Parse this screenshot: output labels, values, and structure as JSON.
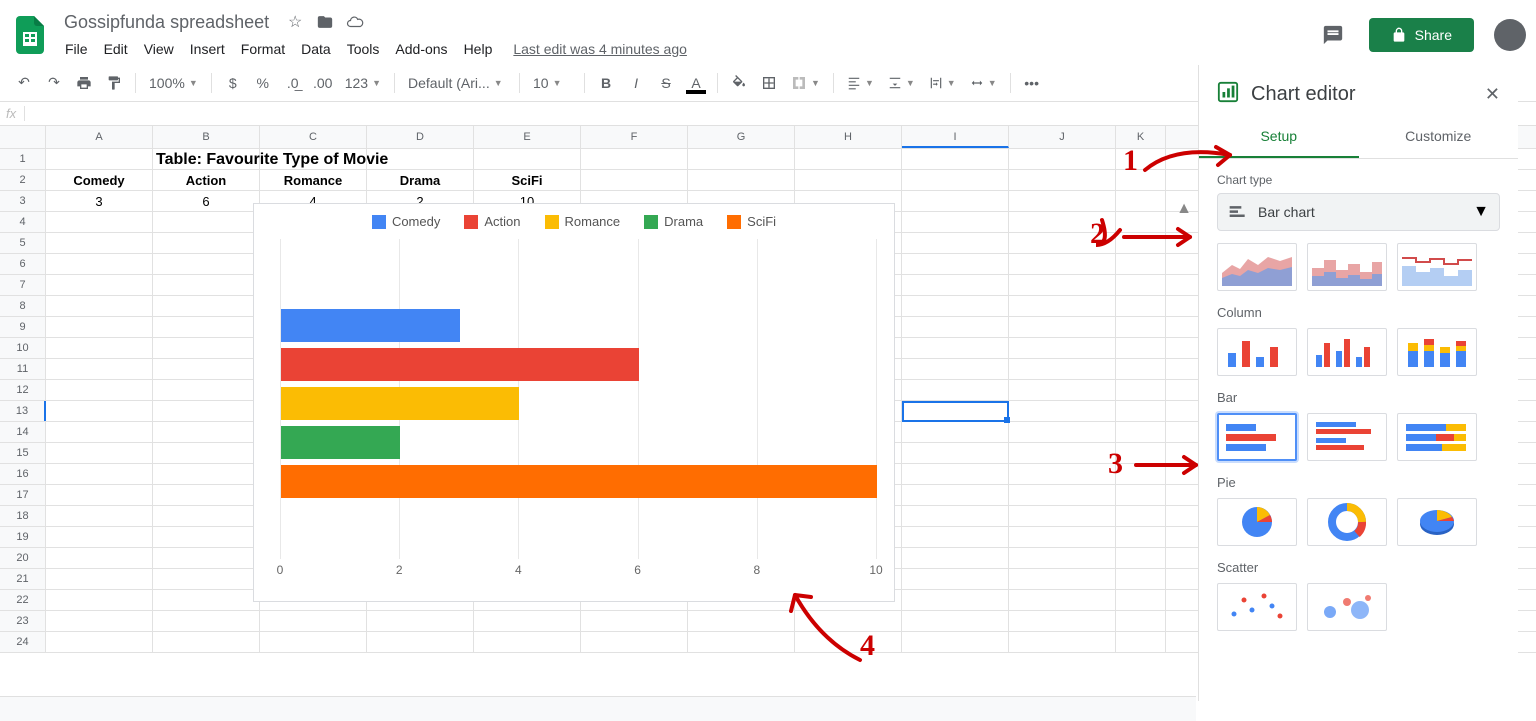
{
  "header": {
    "title": "Gossipfunda spreadsheet",
    "menus": [
      "File",
      "Edit",
      "View",
      "Insert",
      "Format",
      "Data",
      "Tools",
      "Add-ons",
      "Help"
    ],
    "last_edit": "Last edit was 4 minutes ago",
    "share": "Share"
  },
  "toolbar": {
    "zoom": "100%",
    "font": "Default (Ari...",
    "font_size": "10",
    "num_fmt": "123"
  },
  "grid": {
    "columns": [
      "A",
      "B",
      "C",
      "D",
      "E",
      "F",
      "G",
      "H",
      "I",
      "J",
      "K"
    ],
    "title_cell": "Table: Favourite Type of Movie",
    "headers": [
      "Comedy",
      "Action",
      "Romance",
      "Drama",
      "SciFi"
    ],
    "values": [
      "3",
      "6",
      "4",
      "2",
      "10"
    ],
    "row_count": 24,
    "selected": "I13"
  },
  "chart_data": {
    "type": "bar",
    "categories": [
      "Comedy",
      "Action",
      "Romance",
      "Drama",
      "SciFi"
    ],
    "values": [
      3,
      6,
      4,
      2,
      10
    ],
    "colors": [
      "#4285f4",
      "#ea4335",
      "#fbbc04",
      "#34a853",
      "#ff6d01"
    ],
    "xlim": [
      0,
      10
    ],
    "x_ticks": [
      0,
      2,
      4,
      6,
      8,
      10
    ],
    "title": "",
    "xlabel": "",
    "ylabel": ""
  },
  "sidebar": {
    "title": "Chart editor",
    "tabs": {
      "setup": "Setup",
      "customize": "Customize"
    },
    "chart_type_label": "Chart type",
    "chart_type_value": "Bar chart",
    "sections": {
      "column": "Column",
      "bar": "Bar",
      "pie": "Pie",
      "scatter": "Scatter"
    }
  }
}
